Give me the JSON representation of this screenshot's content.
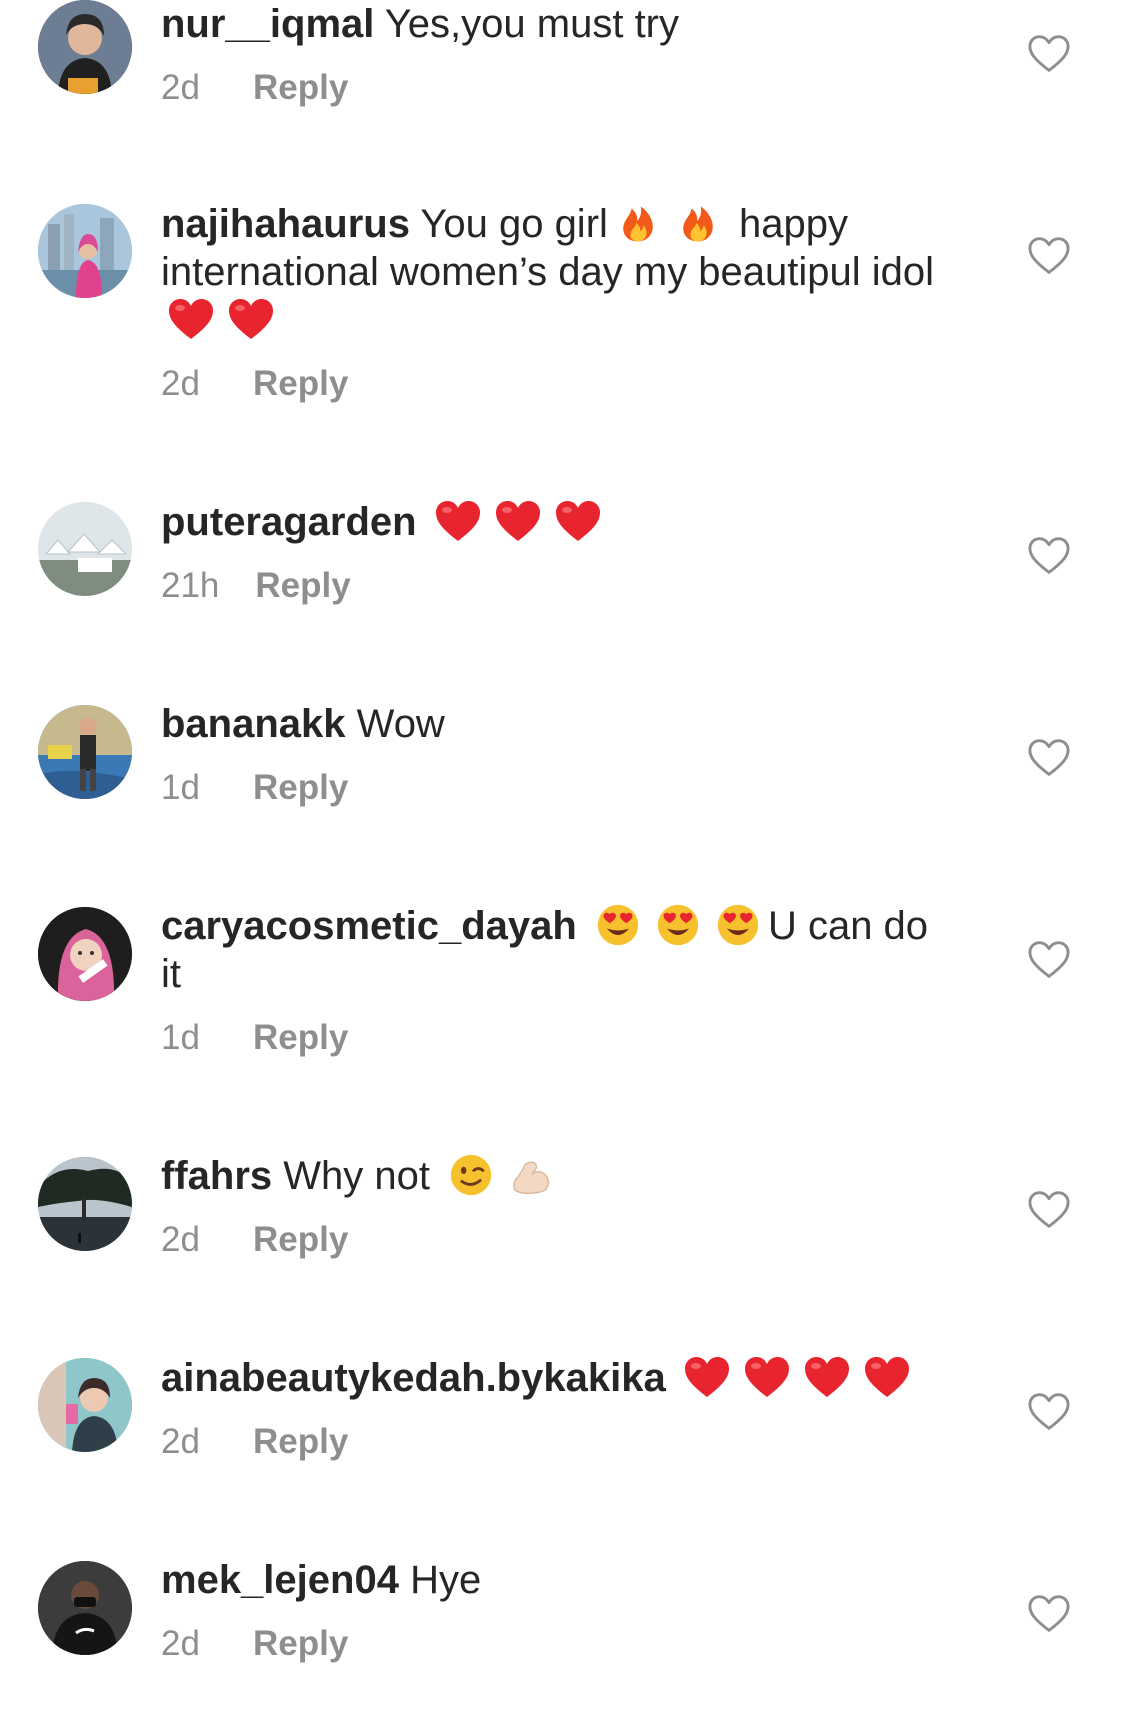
{
  "comments": [
    {
      "username": "nur__iqmal",
      "text": "Yes,you must try",
      "emojis": [],
      "text_after": "",
      "time": "2d",
      "reply_label": "Reply",
      "avatar": "portrait-dark-hood",
      "avatar_color": "#3a4356"
    },
    {
      "username": "najihahaurus",
      "text": "You go girl",
      "emojis": [
        "fire-emoji",
        "fire-emoji"
      ],
      "text_after": "happy international women’s day my beautipul idol",
      "trailing_emojis": [
        "heart-emoji",
        "heart-emoji"
      ],
      "time": "2d",
      "reply_label": "Reply",
      "avatar": "city-skyline-hijab",
      "avatar_color": "#7aa7c8"
    },
    {
      "username": "puteragarden",
      "text": "",
      "emojis": [
        "heart-emoji",
        "heart-emoji",
        "heart-emoji"
      ],
      "text_after": "",
      "time": "21h",
      "reply_label": "Reply",
      "avatar": "white-tents",
      "avatar_color": "#cfd8dc"
    },
    {
      "username": "bananakk",
      "text": "Wow",
      "emojis": [],
      "text_after": "",
      "time": "1d",
      "reply_label": "Reply",
      "avatar": "street-photo",
      "avatar_color": "#3f6fa0"
    },
    {
      "username": "caryacosmetic_dayah",
      "text": "",
      "emojis": [
        "heart-eyes-emoji",
        "heart-eyes-emoji",
        "heart-eyes-emoji"
      ],
      "text_after": "U can do it",
      "time": "1d",
      "reply_label": "Reply",
      "avatar": "pink-hijab-selfie",
      "avatar_color": "#2a2a2a"
    },
    {
      "username": "ffahrs",
      "text": "Why not",
      "emojis": [
        "wink-emoji",
        "flexed-bicep-emoji"
      ],
      "text_after": "",
      "time": "2d",
      "reply_label": "Reply",
      "avatar": "sunset-tree",
      "avatar_color": "#4a5a6a"
    },
    {
      "username": "ainabeautykedah.bykakika",
      "text": "",
      "emojis": [
        "heart-emoji",
        "heart-emoji",
        "heart-emoji",
        "heart-emoji"
      ],
      "text_after": "",
      "time": "2d",
      "reply_label": "Reply",
      "avatar": "mirror-selfie",
      "avatar_color": "#5aa0a8"
    },
    {
      "username": "mek_lejen04",
      "text": "Hye",
      "emojis": [],
      "text_after": "",
      "time": "2d",
      "reply_label": "Reply",
      "avatar": "masked-man",
      "avatar_color": "#2b2b2b"
    }
  ],
  "colors": {
    "text": "#262626",
    "meta": "#8e8e8e",
    "heart_red": "#e8242e",
    "icon_stroke": "#8e8e8e"
  }
}
